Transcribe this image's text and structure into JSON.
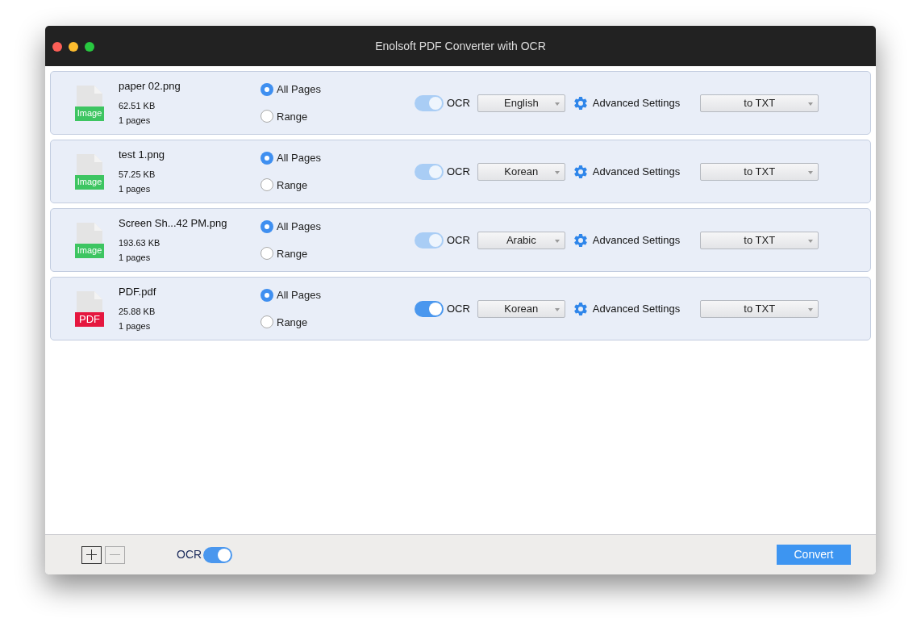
{
  "window": {
    "title": "Enolsoft PDF Converter with OCR"
  },
  "files": [
    {
      "kind": "image",
      "badge": "Image",
      "name": "paper 02.png",
      "size": "62.51 KB",
      "pages": "1 pages",
      "page_options": [
        {
          "label": "All Pages",
          "selected": true
        },
        {
          "label": "Range",
          "selected": false
        }
      ],
      "ocr": {
        "label": "OCR",
        "on": true,
        "disabled": true
      },
      "language": "English",
      "advanced": "Advanced Settings",
      "format": "to TXT"
    },
    {
      "kind": "image",
      "badge": "Image",
      "name": "test 1.png",
      "size": "57.25 KB",
      "pages": "1 pages",
      "page_options": [
        {
          "label": "All Pages",
          "selected": true
        },
        {
          "label": "Range",
          "selected": false
        }
      ],
      "ocr": {
        "label": "OCR",
        "on": true,
        "disabled": true
      },
      "language": "Korean",
      "advanced": "Advanced Settings",
      "format": "to TXT"
    },
    {
      "kind": "image",
      "badge": "Image",
      "name": "Screen Sh...42 PM.png",
      "size": "193.63 KB",
      "pages": "1 pages",
      "page_options": [
        {
          "label": "All Pages",
          "selected": true
        },
        {
          "label": "Range",
          "selected": false
        }
      ],
      "ocr": {
        "label": "OCR",
        "on": true,
        "disabled": true
      },
      "language": "Arabic",
      "advanced": "Advanced Settings",
      "format": "to TXT"
    },
    {
      "kind": "pdf",
      "badge": "PDF",
      "name": "PDF.pdf",
      "size": "25.88 KB",
      "pages": "1 pages",
      "page_options": [
        {
          "label": "All Pages",
          "selected": true
        },
        {
          "label": "Range",
          "selected": false
        }
      ],
      "ocr": {
        "label": "OCR",
        "on": true,
        "disabled": false
      },
      "language": "Korean",
      "advanced": "Advanced Settings",
      "format": "to TXT"
    }
  ],
  "footer": {
    "add_disabled": false,
    "remove_disabled": true,
    "ocr": {
      "label": "OCR",
      "on": true
    },
    "convert": "Convert"
  }
}
